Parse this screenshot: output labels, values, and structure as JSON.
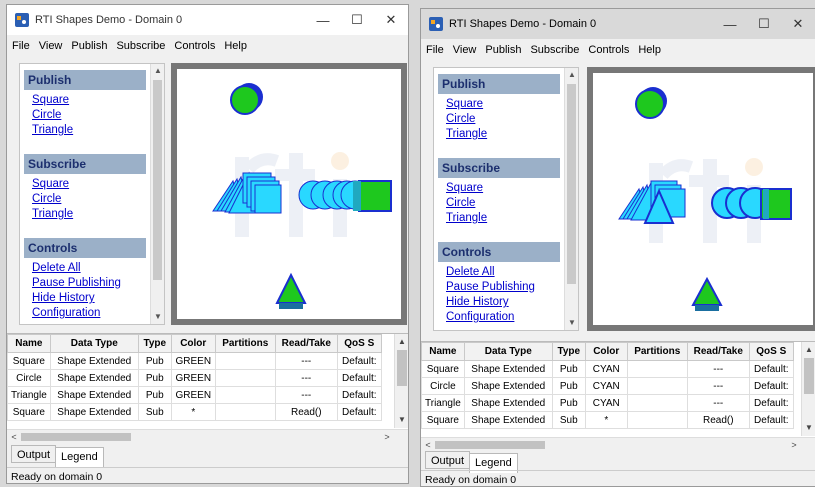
{
  "windows": [
    {
      "title": "RTI Shapes Demo - Domain 0",
      "menu": [
        "File",
        "View",
        "Publish",
        "Subscribe",
        "Controls",
        "Help"
      ],
      "sidebar": {
        "publish": {
          "header": "Publish",
          "links": [
            "Square",
            "Circle",
            "Triangle"
          ]
        },
        "subscribe": {
          "header": "Subscribe",
          "links": [
            "Square",
            "Circle",
            "Triangle"
          ]
        },
        "controls": {
          "header": "Controls",
          "links": [
            "Delete All",
            "Pause Publishing",
            "Hide History",
            "Configuration"
          ]
        }
      },
      "table": {
        "columns": [
          "Name",
          "Data Type",
          "Type",
          "Color",
          "Partitions",
          "Read/Take",
          "QoS S"
        ],
        "rows": [
          [
            "Square",
            "Shape Extended",
            "Pub",
            "GREEN",
            "",
            "---",
            "Default:"
          ],
          [
            "Circle",
            "Shape Extended",
            "Pub",
            "GREEN",
            "",
            "---",
            "Default:"
          ],
          [
            "Triangle",
            "Shape Extended",
            "Pub",
            "GREEN",
            "",
            "---",
            "Default:"
          ],
          [
            "Square",
            "Shape Extended",
            "Sub",
            "*",
            "",
            "Read()",
            "Default:"
          ]
        ]
      },
      "tabs": [
        "Output",
        "Legend"
      ],
      "status": "Ready on domain 0"
    },
    {
      "title": "RTI Shapes Demo - Domain 0",
      "menu": [
        "File",
        "View",
        "Publish",
        "Subscribe",
        "Controls",
        "Help"
      ],
      "sidebar": {
        "publish": {
          "header": "Publish",
          "links": [
            "Square",
            "Circle",
            "Triangle"
          ]
        },
        "subscribe": {
          "header": "Subscribe",
          "links": [
            "Square",
            "Circle",
            "Triangle"
          ]
        },
        "controls": {
          "header": "Controls",
          "links": [
            "Delete All",
            "Pause Publishing",
            "Hide History",
            "Configuration"
          ]
        }
      },
      "table": {
        "columns": [
          "Name",
          "Data Type",
          "Type",
          "Color",
          "Partitions",
          "Read/Take",
          "QoS S"
        ],
        "rows": [
          [
            "Square",
            "Shape Extended",
            "Pub",
            "CYAN",
            "",
            "---",
            "Default:"
          ],
          [
            "Circle",
            "Shape Extended",
            "Pub",
            "CYAN",
            "",
            "---",
            "Default:"
          ],
          [
            "Triangle",
            "Shape Extended",
            "Pub",
            "CYAN",
            "",
            "---",
            "Default:"
          ],
          [
            "Square",
            "Shape Extended",
            "Sub",
            "*",
            "",
            "Read()",
            "Default:"
          ]
        ]
      },
      "tabs": [
        "Output",
        "Legend"
      ],
      "status": "Ready on domain 0"
    }
  ],
  "icons": {
    "minimize": "minimize-icon",
    "maximize": "maximize-icon",
    "close": "close-icon"
  },
  "colors": {
    "green": "#1ec81e",
    "cyan": "#29d8ff",
    "outline": "#1a2fd0",
    "header_bg": "#9bb0c8",
    "link": "#0000cc"
  }
}
